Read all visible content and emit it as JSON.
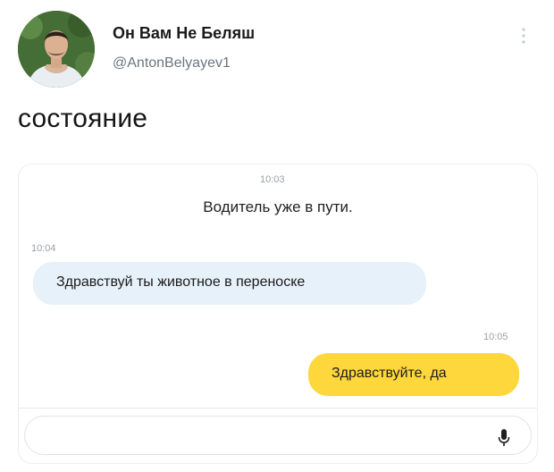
{
  "tweet": {
    "author": {
      "display_name": "Он Вам Не Беляш",
      "handle": "@AntonBelyayev1",
      "avatar_icon": "user-avatar-photo"
    },
    "menu_icon": "vertical-dots-icon",
    "text": "состояние"
  },
  "chat": {
    "messages": [
      {
        "kind": "system",
        "time": "10:03",
        "text": "Водитель уже в пути."
      },
      {
        "kind": "incoming",
        "time": "10:04",
        "text": "Здравствуй ты животное в переноске"
      },
      {
        "kind": "outgoing",
        "time": "10:05",
        "text": "Здравствуйте, да"
      }
    ],
    "input": {
      "placeholder": "",
      "mic_icon": "microphone-icon"
    },
    "colors": {
      "incoming_bubble": "#e7f1f9",
      "outgoing_bubble": "#fdd73b"
    }
  }
}
